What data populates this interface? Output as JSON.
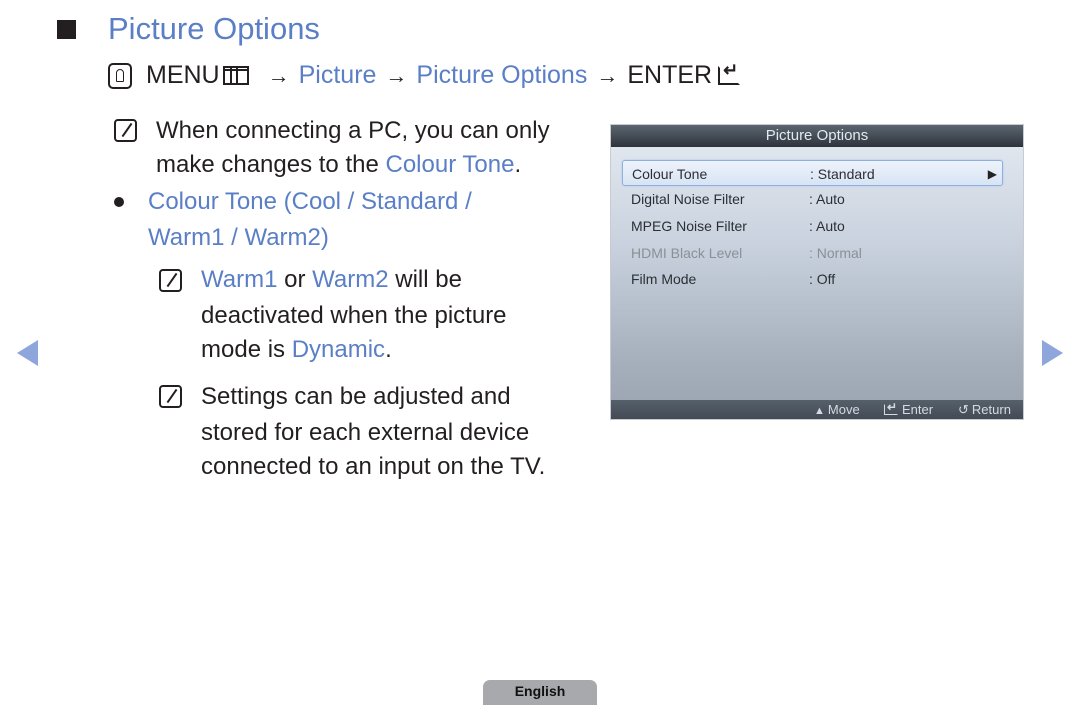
{
  "heading": {
    "title": "Picture Options"
  },
  "menu_path": {
    "menu_label": "MENU",
    "arrow": "→",
    "step1": "Picture",
    "step2": "Picture Options",
    "enter_label": "ENTER"
  },
  "notes": {
    "note1": {
      "line1": "When connecting a PC, you can only",
      "line2_prefix": "make changes to the ",
      "line2_link": "Colour Tone",
      "line2_suffix": "."
    },
    "bullet": {
      "line1": "Colour Tone (Cool / Standard /",
      "line2": "Warm1 / Warm2)"
    },
    "note2": {
      "w1": "Warm1",
      "or": " or ",
      "w2": "Warm2",
      "tail": " will be",
      "line2": "deactivated when the picture",
      "line3_prefix": "mode is ",
      "line3_link": "Dynamic",
      "line3_suffix": "."
    },
    "note3": {
      "line1": "Settings can be adjusted and",
      "line2": "stored for each external device",
      "line3": "connected to an input on the TV."
    }
  },
  "osd": {
    "title": "Picture Options",
    "rows": [
      {
        "label": "Colour Tone",
        "value": ": Standard",
        "selected": true,
        "disabled": false
      },
      {
        "label": "Digital Noise Filter",
        "value": ": Auto",
        "selected": false,
        "disabled": false
      },
      {
        "label": "MPEG Noise Filter",
        "value": ": Auto",
        "selected": false,
        "disabled": false
      },
      {
        "label": "HDMI Black Level",
        "value": ": Normal",
        "selected": false,
        "disabled": true
      },
      {
        "label": "Film Mode",
        "value": ": Off",
        "selected": false,
        "disabled": false
      }
    ],
    "footer": {
      "move": "Move",
      "enter": "Enter",
      "return": "Return"
    }
  },
  "language_tab": "English",
  "colors": {
    "accent_blue": "#5a7fc6",
    "nav_arrow": "#8fa6dd",
    "text": "#231f20"
  }
}
